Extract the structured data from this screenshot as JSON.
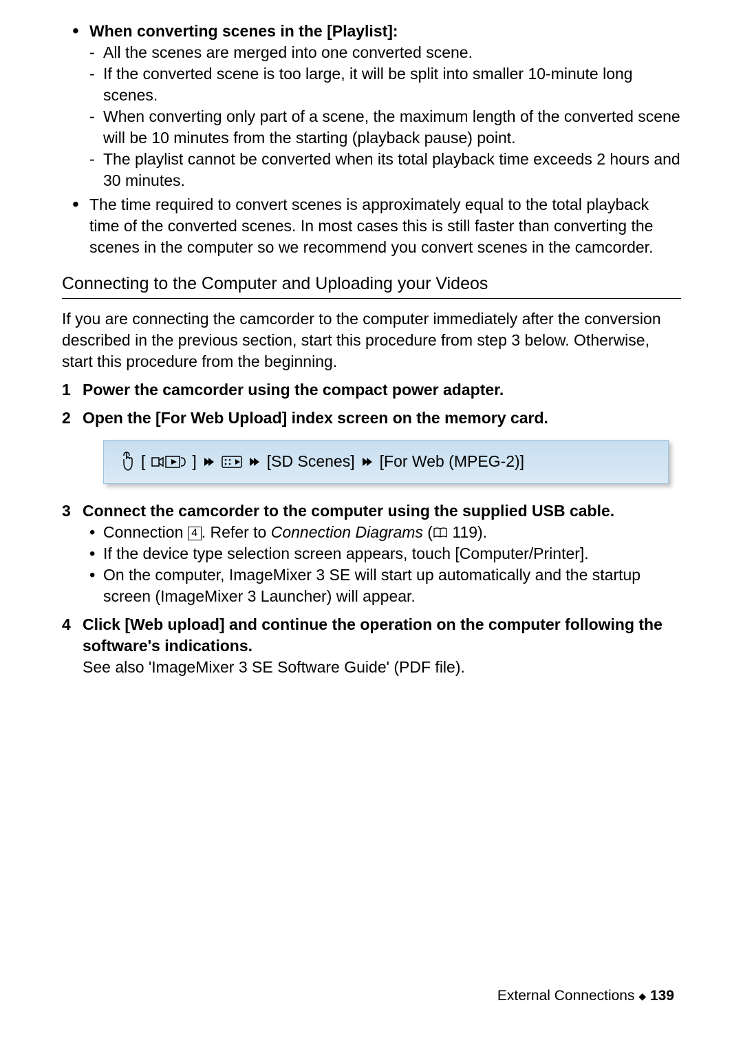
{
  "top": {
    "playlist_heading": "When converting scenes in the [Playlist]:",
    "d1": "All the scenes are merged into one converted scene.",
    "d2": "If the converted scene is too large, it will be split into smaller 10-minute long scenes.",
    "d3": "When converting only part of a scene, the maximum length of the converted scene will be 10 minutes from the starting (playback pause) point.",
    "d4": "The playlist cannot be converted when its total playback time exceeds 2 hours and 30 minutes.",
    "time_note": "The time required to convert scenes is approximately equal to the total playback time of the converted scenes. In most cases this is still faster than converting the scenes in the computer so we recommend you convert scenes in the camcorder."
  },
  "section_title": "Connecting to the Computer and Uploading your Videos",
  "intro": "If you are connecting the camcorder to the computer immediately after the conversion described in the previous section, start this procedure from step 3 below. Otherwise, start this procedure from the beginning.",
  "steps": {
    "n1": "1",
    "t1": "Power the camcorder using the compact power adapter.",
    "n2": "2",
    "t2": "Open the [For Web Upload] index screen on the memory card.",
    "n3": "3",
    "t3": "Connect the camcorder to the computer using the supplied USB cable.",
    "n4": "4",
    "t4": "Click [Web upload] and continue the operation on the computer following the software's indications."
  },
  "nav": {
    "seg1": "[",
    "seg1b": "]",
    "seg2": "[SD Scenes]",
    "seg3": "[For Web (MPEG-2)]"
  },
  "step3_sub": {
    "a_pre": "Connection ",
    "a_num": "4",
    "a_mid": ". Refer to ",
    "a_italic": "Connection Diagrams",
    "a_paren_open": " (",
    "a_page": " 119).",
    "b": "If the device type selection screen appears, touch [Computer/Printer].",
    "c": "On the computer, ImageMixer 3 SE will start up automatically and the startup screen (ImageMixer 3 Launcher) will appear."
  },
  "step4_sub": "See also 'ImageMixer 3 SE Software Guide' (PDF file).",
  "footer_text": "External Connections ",
  "footer_page": "139"
}
